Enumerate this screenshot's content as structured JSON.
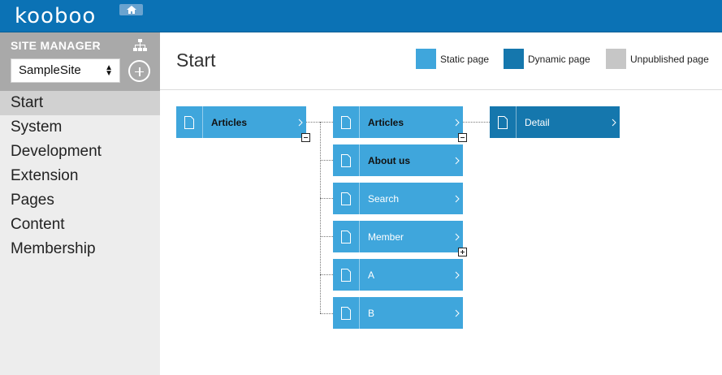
{
  "header": {
    "logo_text": "kooboo",
    "home_icon": "home-icon"
  },
  "sidebar": {
    "title": "SITE MANAGER",
    "site_select_value": "SampleSite",
    "nav": [
      {
        "label": "Start"
      },
      {
        "label": "System"
      },
      {
        "label": "Development"
      },
      {
        "label": "Extension"
      },
      {
        "label": "Pages"
      },
      {
        "label": "Content"
      },
      {
        "label": "Membership"
      }
    ]
  },
  "main": {
    "title": "Start",
    "legend": {
      "static": "Static page",
      "dynamic": "Dynamic page",
      "unpublished": "Unpublished page"
    }
  },
  "tree": {
    "level1": "Articles",
    "level2": [
      "Articles",
      "About us",
      "Search",
      "Member",
      "A",
      "B"
    ],
    "level3": "Detail"
  },
  "colors": {
    "brand": "#0b72b5",
    "static": "#3fa6dc",
    "dynamic": "#1577ad",
    "unpublished": "#c6c6c6"
  }
}
